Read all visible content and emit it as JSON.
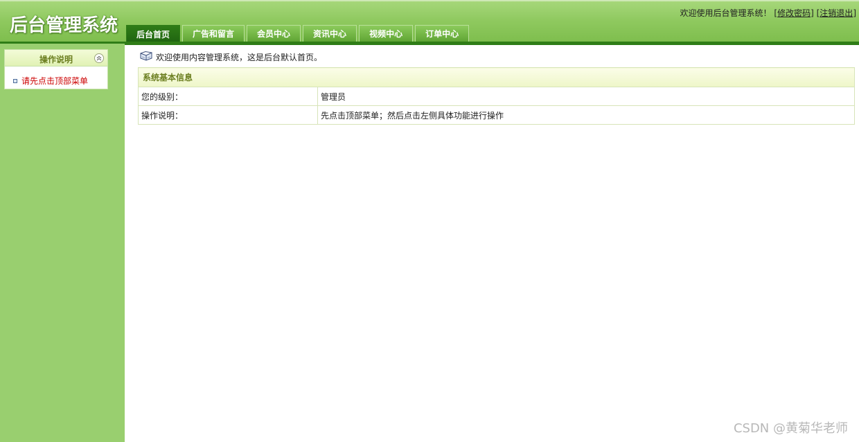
{
  "app": {
    "logo_text": "后台管理系统",
    "welcome_text": "欢迎使用后台管理系统！",
    "change_password_label": "修改密码",
    "logout_label": "注销退出"
  },
  "nav": {
    "tabs": [
      {
        "label": "后台首页",
        "active": true
      },
      {
        "label": "广告和留言",
        "active": false
      },
      {
        "label": "会员中心",
        "active": false
      },
      {
        "label": "资讯中心",
        "active": false
      },
      {
        "label": "视频中心",
        "active": false
      },
      {
        "label": "订单中心",
        "active": false
      }
    ]
  },
  "sidebar": {
    "panel_title": "操作说明",
    "items": [
      {
        "label": "请先点击顶部菜单"
      }
    ]
  },
  "main": {
    "intro_text": "欢迎使用内容管理系统，这是后台默认首页。",
    "table": {
      "title": "系统基本信息",
      "rows": [
        {
          "label": "您的级别：",
          "value": "管理员"
        },
        {
          "label": "操作说明：",
          "value": "先点击顶部菜单；然后点击左侧具体功能进行操作"
        }
      ]
    }
  },
  "watermark": "CSDN @黄菊华老师",
  "colors": {
    "header_green": "#8fc95f",
    "active_tab": "#2f7d17",
    "sidebar_bg": "#99cf6f",
    "menu_item_red": "#cc0000"
  },
  "icons": {
    "intro_icon": "book-icon",
    "collapse_icon": "chevron-up-icon"
  }
}
